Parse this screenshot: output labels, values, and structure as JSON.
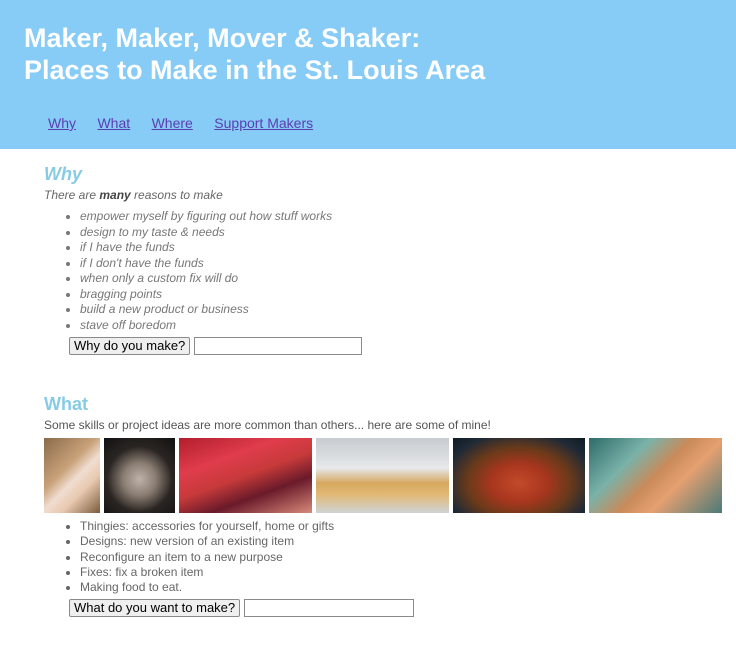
{
  "header": {
    "title_line1": "Maker, Maker, Mover & Shaker:",
    "title_line2": "Places to Make in the St. Louis Area",
    "bg_color": "#87cbf7"
  },
  "nav": {
    "items": [
      {
        "label": "Why"
      },
      {
        "label": "What"
      },
      {
        "label": "Where"
      },
      {
        "label": "Support Makers"
      }
    ]
  },
  "why": {
    "heading": "Why",
    "intro_before": "There are ",
    "intro_emph": "many",
    "intro_after": " reasons to make",
    "items": [
      "empower myself by figuring out how stuff works",
      "design to my taste & needs",
      "if I have the funds",
      "if I don't have the funds",
      "when only a custom fix will do",
      "bragging points",
      "build a new product or business",
      "stave off boredom"
    ],
    "button_label": "Why do you make?",
    "input_value": ""
  },
  "what": {
    "heading": "What",
    "intro": "Some skills or project ideas are more common than others... here are some of mine!",
    "photos": [
      {
        "name": "photo-person-with-mask"
      },
      {
        "name": "photo-bearded-man-hat"
      },
      {
        "name": "photo-red-loom"
      },
      {
        "name": "photo-lace-doilies"
      },
      {
        "name": "photo-pepperoni-pizza"
      },
      {
        "name": "photo-bread-shape"
      }
    ],
    "items": [
      "Thingies: accessories for yourself, home or gifts",
      "Designs: new version of an existing item",
      "Reconfigure an item to a new purpose",
      "Fixes: fix a broken item",
      "Making food to eat."
    ],
    "button_label": "What do you want to make?",
    "input_value": ""
  }
}
